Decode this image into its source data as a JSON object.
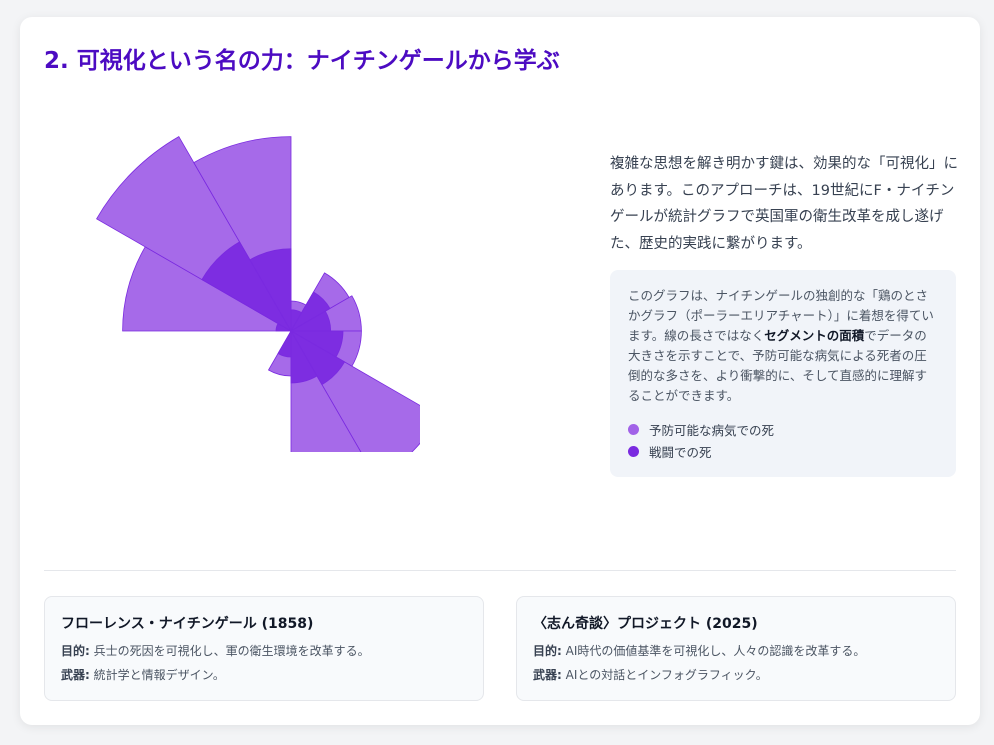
{
  "title": "2. 可視化という名の力：ナイチンゲールから学ぶ",
  "intro": "複雑な思想を解き明かす鍵は、効果的な「可視化」にあります。このアプローチは、19世紀にF・ナイチンゲールが統計グラフで英国軍の衛生改革を成し遂げた、歴史的実践に繋がります。",
  "infobox": {
    "text_before": "このグラフは、ナイチンゲールの独創的な「鶏のとさかグラフ（ポーラーエリアチャート）」に着想を得ています。線の長さではなく",
    "text_bold": "セグメントの面積",
    "text_after": "でデータの大きさを示すことで、予防可能な病気による死者の圧倒的な多さを、より衝撃的に、そして直感的に理解することができます。"
  },
  "legend": [
    {
      "label": "予防可能な病気での死",
      "color": "#a162e8"
    },
    {
      "label": "戦闘での死",
      "color": "#7a2ae0"
    }
  ],
  "cards": [
    {
      "title": "フローレンス・ナイチンゲール (1858)",
      "purpose_label": "目的:",
      "purpose": "兵士の死因を可視化し、軍の衛生環境を改革する。",
      "weapon_label": "武器:",
      "weapon": "統計学と情報デザイン。"
    },
    {
      "title": "〈志ん奇談〉プロジェクト (2025)",
      "purpose_label": "目的:",
      "purpose": "AI時代の価値基準を可視化し、人々の認識を改革する。",
      "weapon_label": "武器:",
      "weapon": "AIとの対話とインフォグラフィック。"
    }
  ],
  "chart_data": {
    "type": "polar-area",
    "series": [
      {
        "name": "予防可能な病気での死",
        "color": "#a162e8",
        "values": [
          126,
          224,
          168,
          4,
          20,
          22,
          22,
          130,
          138,
          9
        ]
      },
      {
        "name": "戦闘での死",
        "color": "#7a2ae0",
        "values": [
          1,
          47,
          30,
          2,
          9,
          7,
          12,
          17,
          12,
          3
        ]
      }
    ],
    "sectors": 12
  }
}
